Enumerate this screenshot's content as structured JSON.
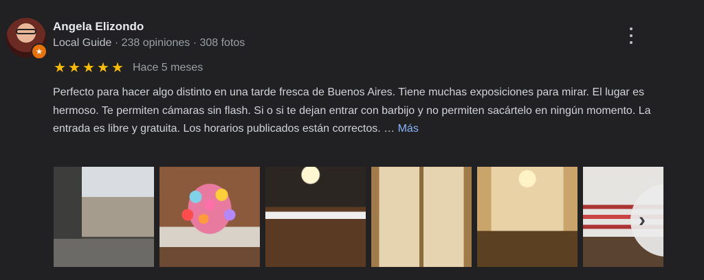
{
  "reviewer": {
    "name": "Angela Elizondo",
    "guide_label": "Local Guide",
    "separator": " · ",
    "reviews_count": "238 opiniones",
    "photos_count": "308 fotos",
    "badge_icon": "local-guide-star-icon"
  },
  "review": {
    "rating": 5,
    "stars": [
      "★",
      "★",
      "★",
      "★",
      "★"
    ],
    "date": "Hace 5 meses",
    "text": "Perfecto para hacer algo distinto en una tarde fresca de Buenos Aires. Tiene muchas exposiciones para mirar. El lugar es hermoso. Te permiten cámaras sin flash. Si o si te dejan entrar con barbijo y no permiten sacártelo en ningún momento. La entrada es libre y gratuita. Los horarios publicados están correctos. … ",
    "more_label": "Más"
  },
  "menu": {
    "icon": "more-vert-icon"
  },
  "photos": {
    "count_visible": 6,
    "next_icon": "chevron-right-icon",
    "next_glyph": "›"
  },
  "colors": {
    "background": "#212124",
    "star": "#fbbc04",
    "link": "#8ab4f8",
    "badge": "#e8710a"
  }
}
